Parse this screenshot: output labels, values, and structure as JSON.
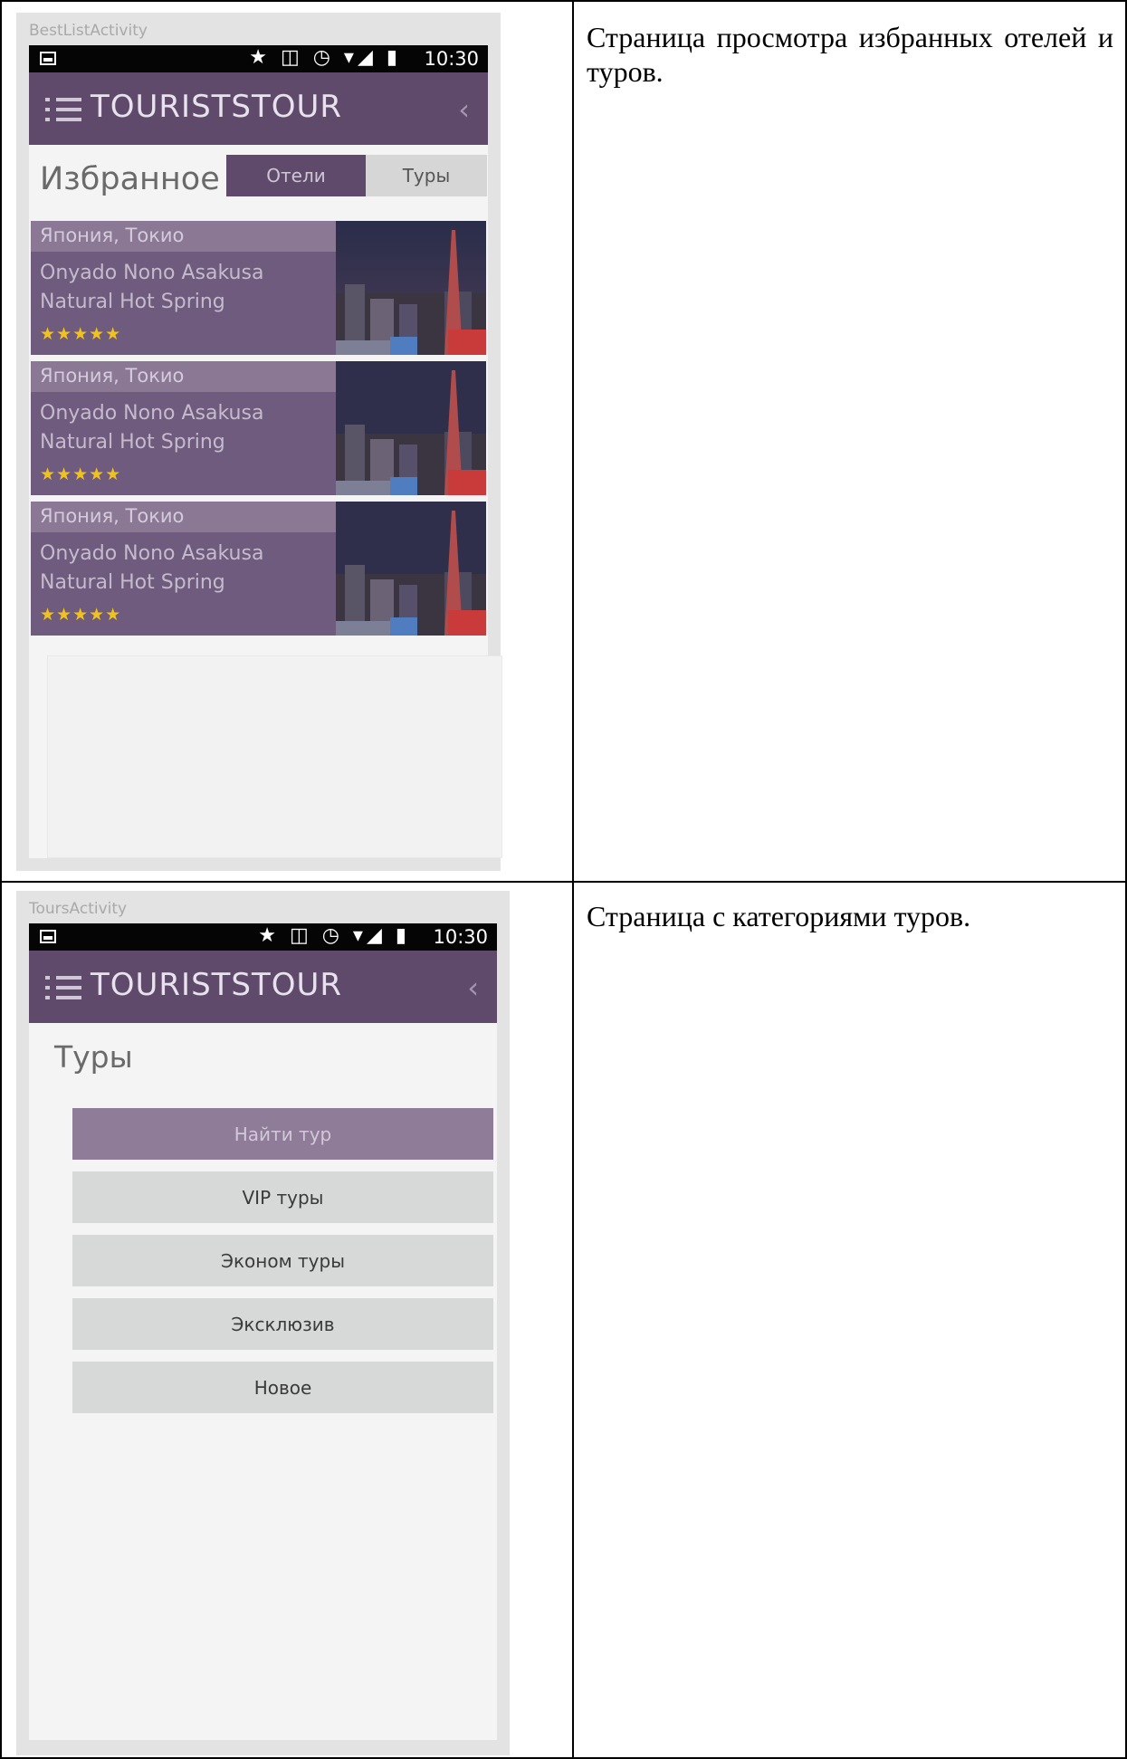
{
  "row1": {
    "caption": "Страница просмотра избранных отелей и туров.",
    "screen": {
      "activity_label": "BestListActivity",
      "status_time": "10:30",
      "status_icons": "★ ◫ ◷ ▾◢ ▮",
      "app_title": "TOURISTSTOUR",
      "back_icon": "‹",
      "page_title": "Избранное",
      "tabs": [
        {
          "label": "Отели",
          "active": true
        },
        {
          "label": "Туры",
          "active": false
        }
      ],
      "cards": [
        {
          "city": "Япония, Токио",
          "name": "Onyado Nono Asakusa Natural Hot Spring",
          "stars": "★★★★★",
          "rating": 5
        },
        {
          "city": "Япония, Токио",
          "name": "Onyado Nono Asakusa Natural Hot Spring",
          "stars": "★★★★★",
          "rating": 5
        },
        {
          "city": "Япония, Токио",
          "name": "Onyado Nono Asakusa Natural Hot Spring",
          "stars": "★★★★★",
          "rating": 5
        }
      ]
    }
  },
  "row2": {
    "caption": "Страница с категориями туров.",
    "screen": {
      "activity_label": "ToursActivity",
      "status_time": "10:30",
      "status_icons": "★ ◫ ◷ ▾◢ ▮",
      "app_title": "TOURISTSTOUR",
      "back_icon": "‹",
      "page_title": "Туры",
      "buttons": [
        {
          "label": "Найти тур"
        },
        {
          "label": "VIP туры"
        },
        {
          "label": "Эконом туры"
        },
        {
          "label": "Эксклюзив"
        },
        {
          "label": "Новое"
        }
      ]
    }
  },
  "colors": {
    "appbar": "#5f4a6c",
    "card": "#6f5b7d",
    "card_city_band": "#8a7895",
    "star": "#f1c21b",
    "primary_button": "#8f7c99",
    "secondary_button": "#d7d9d8"
  }
}
